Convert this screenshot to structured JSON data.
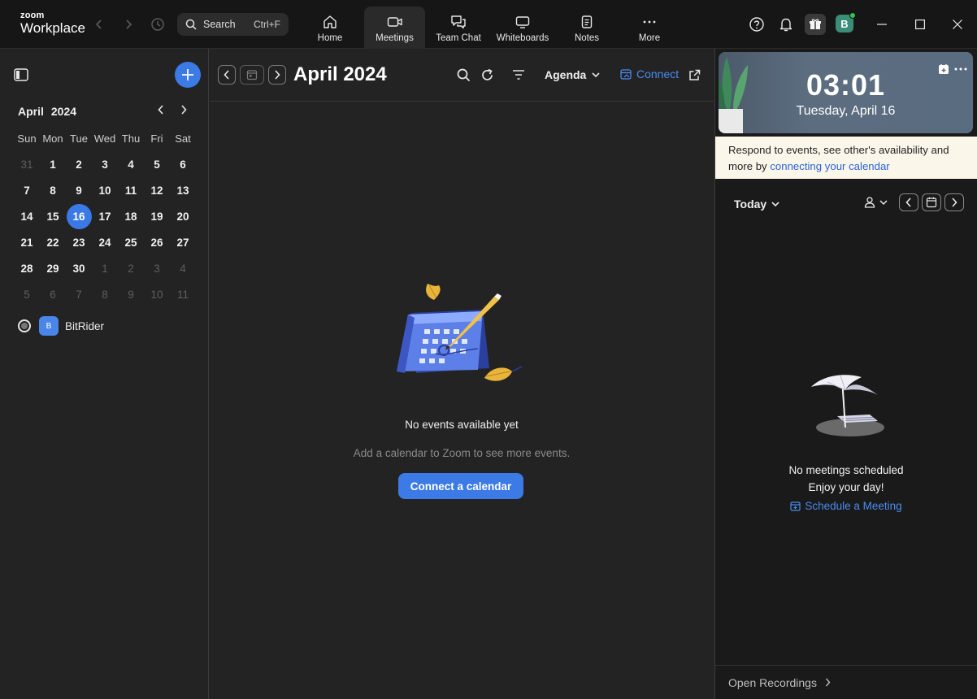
{
  "app": {
    "brand_top": "zoom",
    "brand_bottom": "Workplace"
  },
  "search": {
    "label": "Search",
    "shortcut": "Ctrl+F"
  },
  "tabs": [
    {
      "label": "Home",
      "icon": "home-icon"
    },
    {
      "label": "Meetings",
      "icon": "video-camera-icon"
    },
    {
      "label": "Team Chat",
      "icon": "chat-icon"
    },
    {
      "label": "Whiteboards",
      "icon": "whiteboard-icon"
    },
    {
      "label": "Notes",
      "icon": "notes-icon"
    },
    {
      "label": "More",
      "icon": "ellipsis-icon"
    }
  ],
  "user": {
    "initial": "B",
    "status": "online"
  },
  "mini_calendar": {
    "month": "April",
    "year": "2024",
    "weekdays": [
      "Sun",
      "Mon",
      "Tue",
      "Wed",
      "Thu",
      "Fri",
      "Sat"
    ],
    "weeks": [
      [
        "31",
        "1",
        "2",
        "3",
        "4",
        "5",
        "6"
      ],
      [
        "7",
        "8",
        "9",
        "10",
        "11",
        "12",
        "13"
      ],
      [
        "14",
        "15",
        "16",
        "17",
        "18",
        "19",
        "20"
      ],
      [
        "21",
        "22",
        "23",
        "24",
        "25",
        "26",
        "27"
      ],
      [
        "28",
        "29",
        "30",
        "1",
        "2",
        "3",
        "4"
      ],
      [
        "5",
        "6",
        "7",
        "8",
        "9",
        "10",
        "11"
      ]
    ],
    "selected": "16"
  },
  "account": {
    "badge": "B",
    "name": "BitRider"
  },
  "main": {
    "title": "April 2024",
    "view": "Agenda",
    "connect_label": "Connect",
    "empty_title": "No events available yet",
    "empty_sub": "Add a calendar to Zoom to see more events.",
    "cta": "Connect a calendar"
  },
  "right": {
    "time": "03:01",
    "date": "Tuesday, April 16",
    "notice_text": "Respond to events, see other's availability and more by ",
    "notice_link": "connecting your calendar",
    "today_label": "Today",
    "none_title": "No meetings scheduled",
    "none_sub": "Enjoy your day!",
    "schedule_label": "Schedule a Meeting",
    "footer": "Open Recordings"
  },
  "colors": {
    "accent": "#3c7ae6",
    "link": "#4a8cf0",
    "notice_bg": "#fbf6ea"
  }
}
